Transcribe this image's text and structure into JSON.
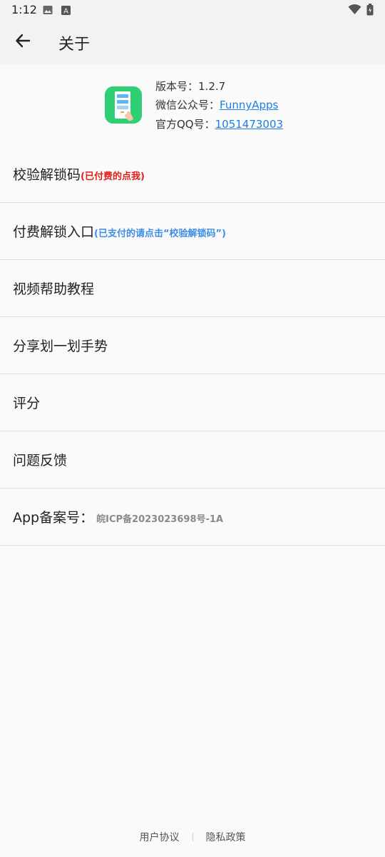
{
  "status_bar": {
    "time": "1:12",
    "icons": [
      "image-icon",
      "a-badge-icon",
      "wifi-icon",
      "battery-icon"
    ]
  },
  "app_bar": {
    "title": "关于",
    "back_icon": "arrow-left-icon"
  },
  "app_info": {
    "icon": "app-logo-icon",
    "version_label": "版本号：",
    "version_value": "1.2.7",
    "wechat_label": "微信公众号：",
    "wechat_value": "FunnyApps",
    "qq_label": "官方QQ号：",
    "qq_value": "1051473003"
  },
  "menu": {
    "items": [
      {
        "label": "校验解锁码",
        "note": "(已付费的点我)"
      },
      {
        "label": "付费解锁入口",
        "note": "(已支付的请点击“校验解锁码”)"
      },
      {
        "label": "视频帮助教程"
      },
      {
        "label": "分享划一划手势"
      },
      {
        "label": "评分"
      },
      {
        "label": "问题反馈"
      },
      {
        "label": "App备案号：",
        "note": "皖ICP备2023023698号-1A"
      }
    ]
  },
  "footer": {
    "user_agreement": "用户协议",
    "privacy_policy": "隐私政策"
  },
  "colors": {
    "accent_link": "#1e7fe0",
    "note_red": "#e0201a",
    "note_blue": "#3e8ee8",
    "app_icon_green": "#2fcf73"
  }
}
